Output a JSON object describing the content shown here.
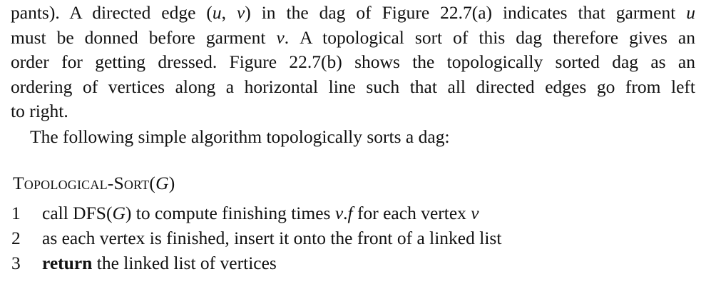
{
  "document": {
    "paragraph1": {
      "line1": {
        "before_math": "pants). A directed edge (",
        "math_u": "u",
        "comma": ", ",
        "math_v": "ν",
        "after_math": ") in the dag of Figure 22.7(a) indicates that garment ",
        "final_math": "u"
      },
      "line2": {
        "before_math": "must be donned before garment ",
        "math_v": "ν",
        "after_math": ". A topological sort of this dag therefore gives an"
      },
      "line3": "order for getting dressed. Figure 22.7(b) shows the topologically sorted dag as an",
      "line4": "ordering of vertices along a horizontal line such that all directed edges go from left",
      "line5": "to right."
    },
    "paragraph2": "The following simple algorithm topologically sorts a dag:",
    "procedure": {
      "title_prefix": "Topological-Sort",
      "title_open": "(",
      "title_arg": "G",
      "title_close": ")",
      "lines": [
        {
          "number": "1",
          "part1": "call DFS",
          "part2": "(",
          "part3": "G",
          "part4": ") to compute finishing times ",
          "part5": "ν",
          "part6": ".",
          "part7": "f",
          "part8": " for each vertex ",
          "part9": "ν"
        },
        {
          "number": "2",
          "text": "as each vertex is finished, insert it onto the front of a linked list"
        },
        {
          "number": "3",
          "keyword": "return",
          "text": " the linked list of vertices"
        }
      ]
    }
  }
}
